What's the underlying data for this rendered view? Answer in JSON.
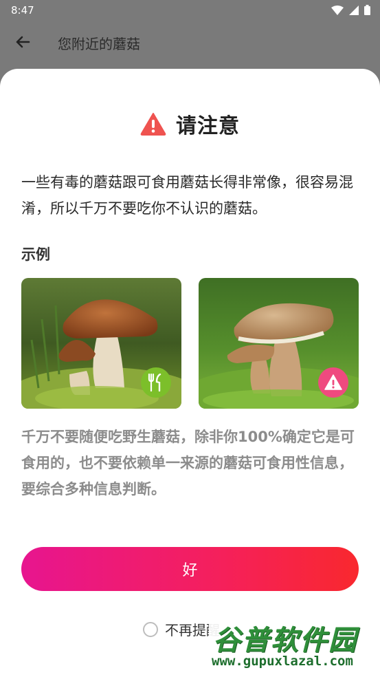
{
  "status_bar": {
    "time": "8:47"
  },
  "app_bar": {
    "title": "您附近的蘑菇"
  },
  "dialog": {
    "title": "请注意",
    "message": "一些有毒的蘑菇跟可食用蘑菇长得非常像，很容易混淆，所以千万不要吃你不认识的蘑菇。",
    "example_label": "示例",
    "examples": [
      {
        "kind": "edible",
        "icon": "fork-knife-icon",
        "badge_color": "#7cbf2a"
      },
      {
        "kind": "poisonous",
        "icon": "warning-icon",
        "badge_color": "#ef4a7f"
      }
    ],
    "note": "千万不要随便吃野生蘑菇，除非你100%确定它是可食用的，也不要依赖单一来源的蘑菇可食用性信息，要综合多种信息判断。",
    "ok_label": "好",
    "checkbox_label": "不再提醒",
    "checkbox_checked": false
  },
  "watermark": {
    "brand": "谷普软件园",
    "url": "www.gupuxlazal.com"
  },
  "colors": {
    "accent_start": "#e7158f",
    "accent_end": "#f9282e",
    "warning": "#ef5350"
  }
}
